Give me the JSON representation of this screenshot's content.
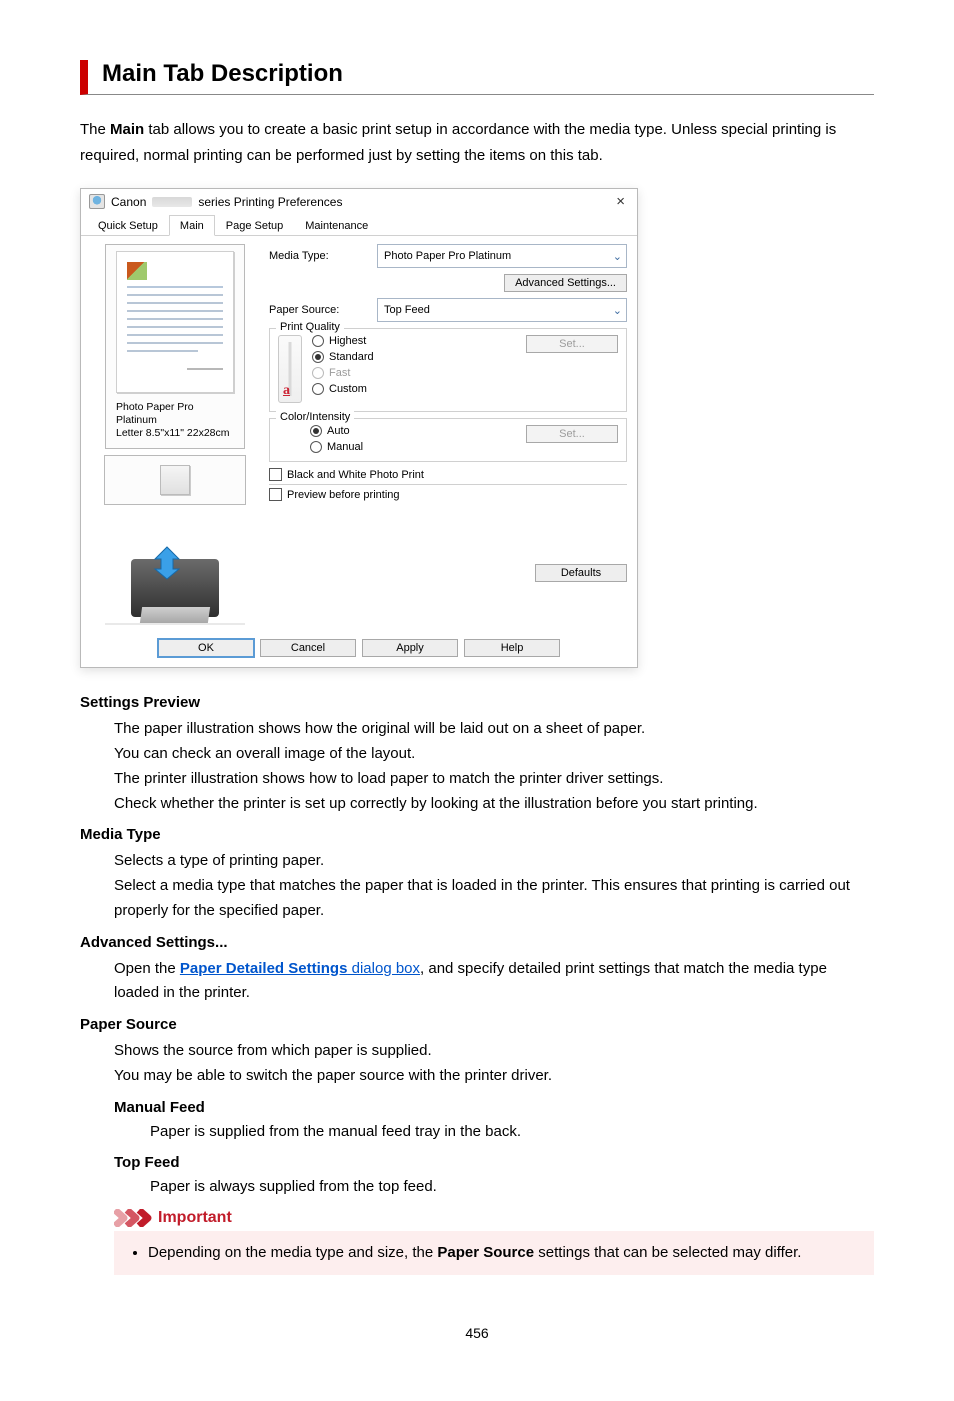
{
  "page": {
    "title": "Main Tab Description",
    "intro_parts": [
      "The ",
      "Main",
      " tab allows you to create a basic print setup in accordance with the media type. Unless special printing is required, normal printing can be performed just by setting the items on this tab."
    ],
    "number": "456"
  },
  "dialog": {
    "title_prefix": "Canon",
    "title_suffix": "series Printing Preferences",
    "close": "×",
    "tabs": {
      "quick_setup": "Quick Setup",
      "main": "Main",
      "page_setup": "Page Setup",
      "maintenance": "Maintenance"
    },
    "labels": {
      "media_type": "Media Type:",
      "paper_source": "Paper Source:",
      "print_quality": "Print Quality",
      "color_intensity": "Color/Intensity",
      "advanced": "Advanced Settings...",
      "set": "Set...",
      "defaults": "Defaults",
      "ok": "OK",
      "cancel": "Cancel",
      "apply": "Apply",
      "help": "Help"
    },
    "values": {
      "media_type": "Photo Paper Pro Platinum",
      "paper_source": "Top Feed",
      "paper_caption1": "Photo Paper Pro Platinum",
      "paper_caption2": "Letter 8.5\"x11\" 22x28cm",
      "slider_letter": "a"
    },
    "quality": {
      "highest": "Highest",
      "standard": "Standard",
      "fast": "Fast",
      "custom": "Custom"
    },
    "color": {
      "auto": "Auto",
      "manual": "Manual"
    },
    "checkboxes": {
      "bw": "Black and White Photo Print",
      "preview": "Preview before printing"
    }
  },
  "sections": {
    "settings_preview": {
      "title": "Settings Preview",
      "body": "The paper illustration shows how the original will be laid out on a sheet of paper.\nYou can check an overall image of the layout.\nThe printer illustration shows how to load paper to match the printer driver settings.\nCheck whether the printer is set up correctly by looking at the illustration before you start printing."
    },
    "media_type": {
      "title": "Media Type",
      "body": "Selects a type of printing paper.\nSelect a media type that matches the paper that is loaded in the printer. This ensures that printing is carried out properly for the specified paper."
    },
    "advanced": {
      "title": "Advanced Settings...",
      "open_the": "Open the ",
      "link_bold": "Paper Detailed Settings",
      "link_rest": " dialog box",
      "after": ", and specify detailed print settings that match the media type loaded in the printer."
    },
    "paper_source": {
      "title": "Paper Source",
      "body": "Shows the source from which paper is supplied.\nYou may be able to switch the paper source with the printer driver.",
      "manual_title": "Manual Feed",
      "manual_body": "Paper is supplied from the manual feed tray in the back.",
      "top_title": "Top Feed",
      "top_body": "Paper is always supplied from the top feed."
    },
    "important": {
      "label": "Important",
      "bullet_parts": [
        "Depending on the media type and size, the ",
        "Paper Source",
        " settings that can be selected may differ."
      ]
    }
  }
}
